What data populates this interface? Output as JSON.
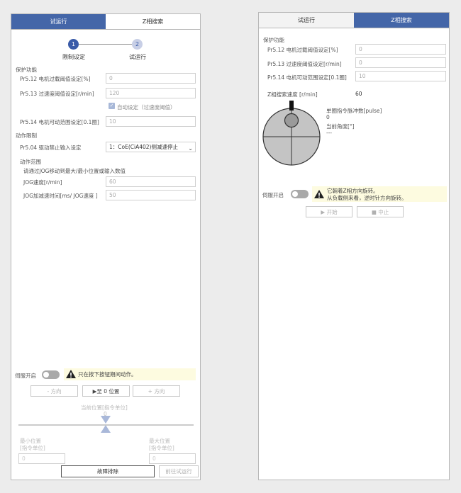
{
  "left": {
    "tabs": {
      "active": "试运行",
      "inactive": "Z相搜索"
    },
    "steps": [
      {
        "num": "1",
        "label": "限制设定"
      },
      {
        "num": "2",
        "label": "试运行"
      }
    ],
    "protection": {
      "title": "保护功能",
      "overload_label": "Pr5.12 电机过载阈值设定[%]",
      "overload_value": "0",
      "overspeed_label": "Pr5.13 过速度阈值设定[r/min]",
      "overspeed_value": "120",
      "auto_label": "自动设定（过速度阈值）",
      "range_label": "Pr5.14 电机可动范围设定[0.1圈]",
      "range_value": "10"
    },
    "limit": {
      "title": "动作限制",
      "input_label": "Pr5.04 驱动禁止输入设定",
      "input_value": "1：CoE(CiA402)侧减速停止"
    },
    "range": {
      "title": "动作范围",
      "hint": "请通过JOG移动到最大/最小位置或输入数值",
      "jog_speed_label": "JOG速度[r/min]",
      "jog_speed_value": "60",
      "jog_acc_label": "JOG加减速时间[ms/ JOG速度 ]",
      "jog_acc_value": "50"
    },
    "servo": {
      "label": "伺服开启",
      "warning": "只在按下按钮期间动作。",
      "minus": "- 方向",
      "zero": "▶至 0 位置",
      "plus": "+ 方向"
    },
    "position": {
      "label": "当前位置[指令单位]",
      "value": "0",
      "min_label1": "最小位置",
      "min_label2": "[指令单位]",
      "min_value": "0",
      "max_label1": "最大位置",
      "max_label2": "[指令单位]",
      "max_value": "0"
    },
    "footer": {
      "fault": "故障排除",
      "next": "前往试运行"
    }
  },
  "right": {
    "tabs": {
      "inactive": "试运行",
      "active": "Z相搜索"
    },
    "protection": {
      "title": "保护功能",
      "overload_label": "Pr5.12 电机过载阈值设定[%]",
      "overload_value": "0",
      "overspeed_label": "Pr5.13 过速度阈值设定[r/min]",
      "overspeed_value": "0",
      "range_label": "Pr5.14 电机可动范围设定[0.1圈]",
      "range_value": "10"
    },
    "zsearch": {
      "speed_label": "Z相搜索速度 [r/min]",
      "speed_value": "60",
      "pulse_label": "单圈指令脉冲数[pulse]",
      "pulse_value": "0",
      "angle_label": "当前角度[°]",
      "angle_value": "---"
    },
    "servo": {
      "label": "伺服开启",
      "warning1": "它朝着Z相方向旋转。",
      "warning2": "从负载侧来看，逆时针方向旋转。",
      "start": "▶ 开始",
      "stop": "■ 中止"
    }
  }
}
